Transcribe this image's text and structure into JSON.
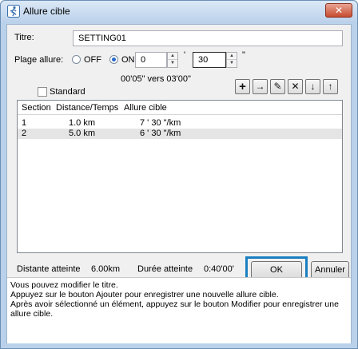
{
  "window": {
    "title": "Allure cible",
    "close_label": "✕"
  },
  "form": {
    "title_label": "Titre:",
    "title_value": "SETTING01",
    "pace_label": "Plage allure:",
    "radio_off_label": "OFF",
    "radio_on_label": "ON",
    "min_value": "0",
    "min_unit": "'",
    "sec_value": "30",
    "sec_unit": "\"",
    "range_text": "00'05\" vers 03'00\"",
    "standard_label": "Standard"
  },
  "toolbar": {
    "add": "+",
    "insert": "→",
    "edit": "✎",
    "delete": "✕",
    "down": "↓",
    "up": "↑"
  },
  "table": {
    "columns": [
      "Section",
      "Distance/Temps",
      "Allure cible"
    ],
    "rows": [
      [
        "1",
        "1.0 km",
        "7  ' 30 \"/km"
      ],
      [
        "2",
        "5.0 km",
        "6  ' 30 \"/km"
      ]
    ]
  },
  "footer": {
    "distance_label": "Distante atteinte",
    "distance_value": "6.00km",
    "duration_label": "Durée atteinte",
    "duration_value": "0:40'00'",
    "ok_label": "OK",
    "cancel_label": "Annuler"
  },
  "help": {
    "line1": "Vous pouvez modifier le titre.",
    "line2": "Appuyez sur le bouton Ajouter pour enregistrer une nouvelle allure cible.",
    "line3": "Après avoir sélectionné un élément, appuyez sur le bouton Modifier pour enregistrer une allure cible."
  },
  "colors": {
    "accent": "#1a7fc0",
    "window_frame": "#b9d1ea"
  }
}
